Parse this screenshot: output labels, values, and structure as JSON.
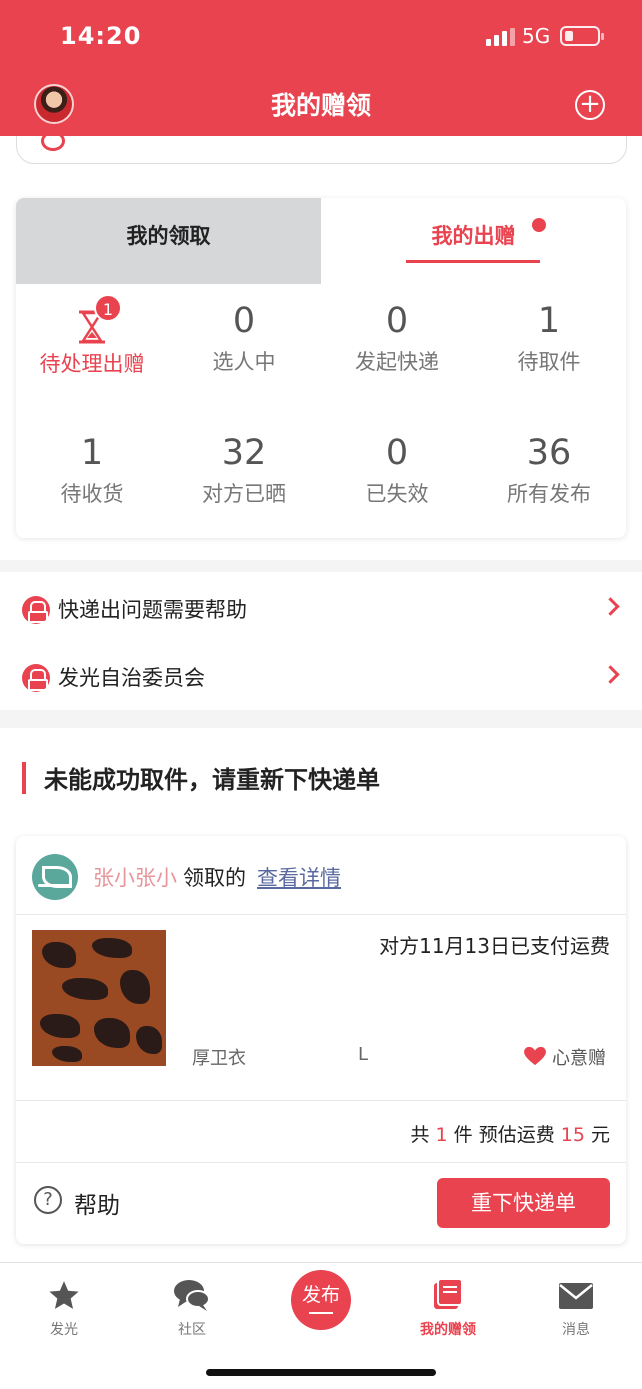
{
  "status_bar": {
    "time": "14:20",
    "network": "5G"
  },
  "header": {
    "title": "我的赠领"
  },
  "tabs": [
    {
      "label": "我的领取"
    },
    {
      "label": "我的出赠"
    }
  ],
  "stats": [
    {
      "value": "",
      "label": "待处理出赠",
      "badge": "1",
      "icon": "hourglass-icon"
    },
    {
      "value": "0",
      "label": "选人中"
    },
    {
      "value": "0",
      "label": "发起快递"
    },
    {
      "value": "1",
      "label": "待取件"
    },
    {
      "value": "1",
      "label": "待收货"
    },
    {
      "value": "32",
      "label": "对方已晒"
    },
    {
      "value": "0",
      "label": "已失效"
    },
    {
      "value": "36",
      "label": "所有发布"
    }
  ],
  "help_links": [
    {
      "label": "快递出问题需要帮助",
      "icon": "service-icon"
    },
    {
      "label": "发光自治委员会",
      "icon": "service-icon"
    }
  ],
  "notice": {
    "title": "未能成功取件，请重新下快递单"
  },
  "order": {
    "user": "张小张小",
    "action": "领取的",
    "detail_link": "查看详情",
    "paid_note": "对方11月13日已支付运费",
    "item_name": "厚卫衣",
    "item_size": "L",
    "item_tag": "心意赠",
    "summary_prefix": "共",
    "count": "1",
    "summary_mid": "件 预估运费",
    "fee": "15",
    "summary_suffix": "元",
    "help_label": "帮助",
    "reorder_label": "重下快递单"
  },
  "tabbar": {
    "items": [
      {
        "label": "发光",
        "icon": "star-icon"
      },
      {
        "label": "社区",
        "icon": "chat-bubbles-icon"
      },
      {
        "label": "我的赠领",
        "icon": "book-icon"
      },
      {
        "label": "消息",
        "icon": "mail-icon"
      }
    ],
    "publish_label": "发布"
  },
  "colors": {
    "accent": "#e8434f",
    "tab_inactive": "#d6d7d9",
    "link": "#5a6aa0",
    "username": "#e8959b"
  }
}
